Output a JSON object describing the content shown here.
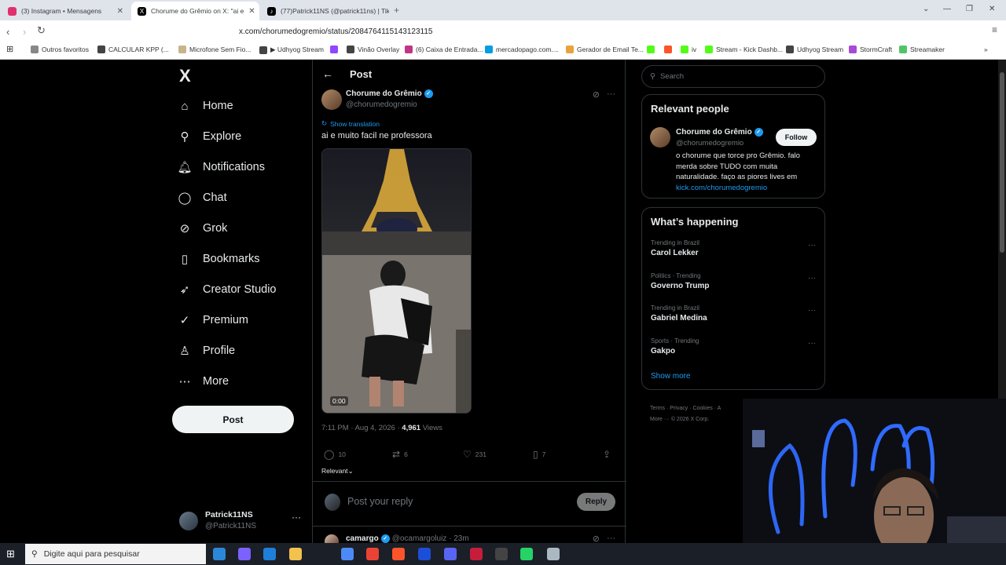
{
  "browser": {
    "tabs": [
      {
        "title": "(3) Instagram • Mensagens",
        "color": "#e1306c",
        "active": false
      },
      {
        "title": "Chorume do Grêmio on X: \"ai e",
        "color": "#000000",
        "active": true
      },
      {
        "title": "(77)Patrick11NS (@patrick11ns) | Tik",
        "color": "#000000",
        "active": false
      }
    ],
    "new_tab": "+",
    "url": "x.com/chorumedogremio/status/2084764115143123115",
    "bookmarks": [
      {
        "label": "Outros favoritos",
        "color": "#888888"
      },
      {
        "label": "CALCULAR KPP (...",
        "color": "#444444"
      },
      {
        "label": "Microfone Sem Fio...",
        "color": "#c8b48a"
      },
      {
        "label": "▶ Udhyog Stream",
        "color": "#444444"
      },
      {
        "label": "",
        "color": "#9146ff"
      },
      {
        "label": "Vinão Overlay",
        "color": "#444444"
      },
      {
        "label": "(6) Caixa de Entrada...",
        "color": "#c13584"
      },
      {
        "label": "mercadopago.com....",
        "color": "#009ee3"
      },
      {
        "label": "Gerador de Email Te...",
        "color": "#e8a33d"
      },
      {
        "label": "",
        "color": "#53fc18"
      },
      {
        "label": "",
        "color": "#fb542b"
      },
      {
        "label": "iv",
        "color": "#53fc18"
      },
      {
        "label": "Stream - Kick Dashb...",
        "color": "#53fc18"
      },
      {
        "label": "Udhyog Stream",
        "color": "#444444"
      },
      {
        "label": "StormCraft",
        "color": "#a94ad6"
      },
      {
        "label": "Streamaker",
        "color": "#53c36b"
      }
    ]
  },
  "nav": {
    "logo": "X",
    "items": [
      {
        "label": "Home",
        "icon": "⌂"
      },
      {
        "label": "Explore",
        "icon": "⚲"
      },
      {
        "label": "Notifications",
        "icon": "🔔︎"
      },
      {
        "label": "Chat",
        "icon": "◯"
      },
      {
        "label": "Grok",
        "icon": "⊘"
      },
      {
        "label": "Bookmarks",
        "icon": "▯"
      },
      {
        "label": "Creator Studio",
        "icon": "➶"
      },
      {
        "label": "Premium",
        "icon": "✓"
      },
      {
        "label": "Profile",
        "icon": "♙"
      },
      {
        "label": "More",
        "icon": "⋯"
      }
    ],
    "post_label": "Post",
    "account": {
      "name": "Patrick11NS",
      "handle": "@Patrick11NS",
      "more": "···"
    }
  },
  "post": {
    "header_title": "Post",
    "author": "Chorume do Grêmio",
    "handle": "@chorumedogremio",
    "translate": "Show translation",
    "text": "ai e muito facil ne professora",
    "video_time": "0:00",
    "timestamp": "7:11 PM · Aug 4, 2026 · ",
    "views_count": "4,961",
    "views_label": " Views",
    "replies": "10",
    "reposts": "6",
    "likes": "231",
    "bookmarks": "7",
    "sort": "Relevant",
    "reply_placeholder": "Post your reply",
    "reply_button": "Reply",
    "next_reply": {
      "name": "camargo",
      "handle": "@ocamargoluiz · 23m"
    }
  },
  "sidebar": {
    "search_placeholder": "Search",
    "relevant_title": "Relevant people",
    "person": {
      "name": "Chorume do Grêmio",
      "handle": "@chorumedogremio",
      "follow": "Follow",
      "bio": "o chorume que torce pro Grêmio. falo merda sobre TUDO com muita naturalidade. faço as piores lives em",
      "link": "kick.com/chorumedogremio"
    },
    "happening_title": "What’s happening",
    "trends": [
      {
        "context": "Trending in Brazil",
        "title": "Carol Lekker"
      },
      {
        "context": "Politics · Trending",
        "title": "Governo Trump"
      },
      {
        "context": "Trending in Brazil",
        "title": "Gabriel Medina"
      },
      {
        "context": "Sports · Trending",
        "title": "Gakpo"
      }
    ],
    "show_more": "Show more",
    "footer_line1": "Terms · Privacy · Cookies · A",
    "footer_line2": "More ··· © 2026 X Corp."
  },
  "taskbar": {
    "search_placeholder": "Digite aqui para pesquisar",
    "apps": [
      "#2b88d8",
      "#7b61ff",
      "#1e7fd8",
      "#f2c14e",
      "#4c8bf5",
      "#ea4335",
      "#fb542b",
      "#1d4ed8",
      "#5865f2",
      "#c41e3a",
      "#444444",
      "#25d366",
      "#aab8c2",
      "#6ab4e8"
    ]
  }
}
